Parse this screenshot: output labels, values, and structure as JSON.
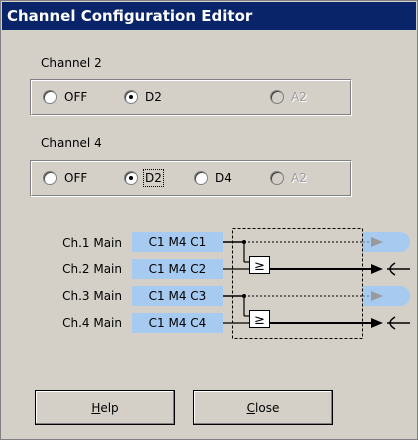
{
  "window": {
    "title": "Channel Configuration Editor"
  },
  "channel2": {
    "label": "Channel 2",
    "options": [
      {
        "label": "OFF",
        "selected": false,
        "enabled": true
      },
      {
        "label": "D2",
        "selected": true,
        "enabled": true
      },
      {
        "label": "A2",
        "selected": false,
        "enabled": false
      }
    ]
  },
  "channel4": {
    "label": "Channel 4",
    "options": [
      {
        "label": "OFF",
        "selected": false,
        "enabled": true
      },
      {
        "label": "D2",
        "selected": true,
        "enabled": true,
        "focused": true
      },
      {
        "label": "D4",
        "selected": false,
        "enabled": true
      },
      {
        "label": "A2",
        "selected": false,
        "enabled": false
      }
    ]
  },
  "routing": {
    "rows": [
      {
        "name": "Ch.1 Main",
        "source": "C1 M4 C1",
        "output": "gray-arrow"
      },
      {
        "name": "Ch.2 Main",
        "source": "C1 M4 C2",
        "output": "black-arrow"
      },
      {
        "name": "Ch.3 Main",
        "source": "C1 M4 C3",
        "output": "gray-arrow"
      },
      {
        "name": "Ch.4 Main",
        "source": "C1 M4 C4",
        "output": "black-arrow"
      }
    ],
    "comparator_symbol": "≥"
  },
  "buttons": {
    "help": {
      "label_underlined": "H",
      "label_rest": "elp"
    },
    "close": {
      "label_underlined": "C",
      "label_rest": "lose"
    }
  },
  "colors": {
    "title_bar": "#0a246a",
    "face": "#d4d0c8",
    "highlight": "#a6caf0"
  }
}
